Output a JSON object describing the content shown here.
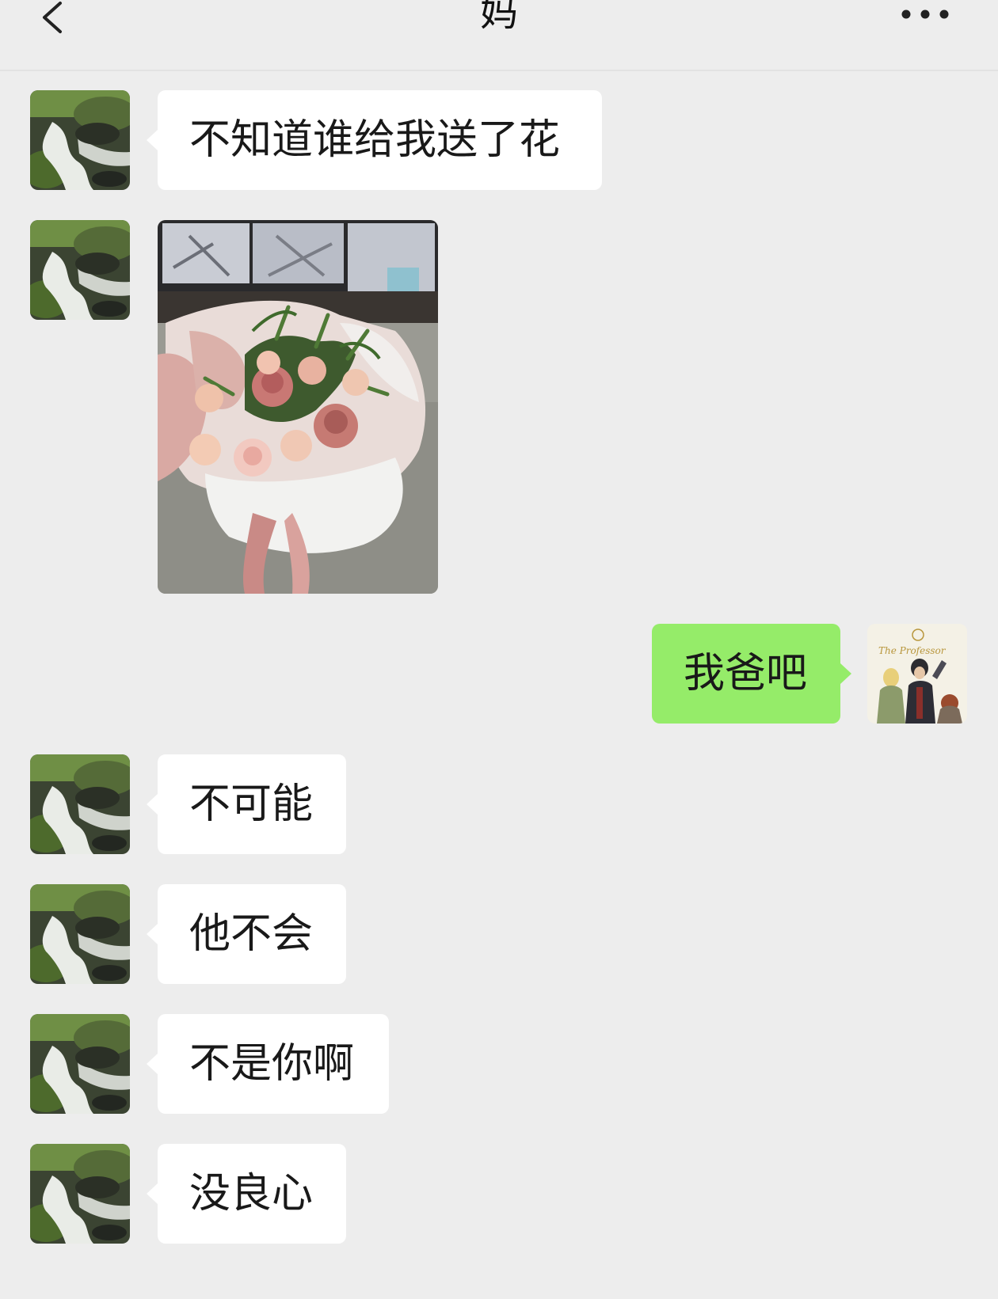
{
  "header": {
    "title": "妈",
    "back_icon": "chevron-left-icon",
    "more_icon": "more-dots-icon"
  },
  "messages": [
    {
      "side": "in",
      "text": "不知道谁给我送了花",
      "avatar": "waterfall-stream-avatar"
    },
    {
      "side": "in",
      "type": "image",
      "description_icon": "flower-bouquet-photo",
      "avatar": "waterfall-stream-avatar"
    },
    {
      "side": "out",
      "text": "我爸吧",
      "avatar": "illustrated-characters-avatar"
    },
    {
      "side": "in",
      "text": "不可能",
      "avatar": "waterfall-stream-avatar"
    },
    {
      "side": "in",
      "text": "他不会",
      "avatar": "waterfall-stream-avatar"
    },
    {
      "side": "in",
      "text": "不是你啊",
      "avatar": "waterfall-stream-avatar"
    },
    {
      "side": "in",
      "text": "没良心",
      "avatar": "waterfall-stream-avatar"
    }
  ],
  "self_avatar_text": "The Professor",
  "colors": {
    "background": "#ededed",
    "incoming_bubble": "#ffffff",
    "outgoing_bubble": "#95ec69"
  }
}
